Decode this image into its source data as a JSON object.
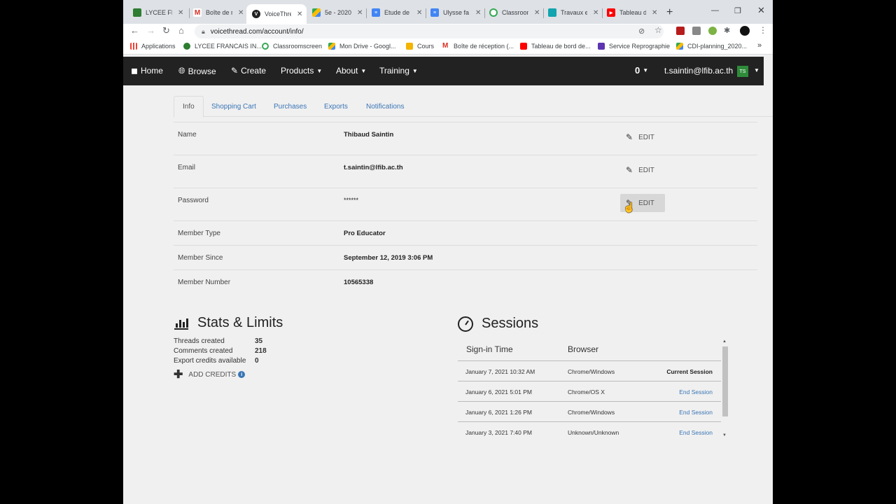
{
  "browser": {
    "tabs": [
      {
        "label": "LYCEE FR",
        "color": "#2e7d32"
      },
      {
        "label": "Boîte de r",
        "color": "#d93025"
      },
      {
        "label": "VoiceThre",
        "color": "#222222"
      },
      {
        "label": "5e - 2020",
        "color": "#1a73e8"
      },
      {
        "label": "Etude de",
        "color": "#4285f4"
      },
      {
        "label": "Ulysse fa",
        "color": "#4285f4"
      },
      {
        "label": "Classroom",
        "color": "#34a853"
      },
      {
        "label": "Travaux e",
        "color": "#12a4af"
      },
      {
        "label": "Tableau d",
        "color": "#ff0000"
      }
    ],
    "new_tab": "+",
    "url": "voicethread.com/account/info/",
    "bookmarks": [
      {
        "label": "Applications",
        "color": "#ea4335"
      },
      {
        "label": "LYCEE FRANCAIS IN...",
        "color": "#2e7d32"
      },
      {
        "label": "Classroomscreen",
        "color": "#34a853"
      },
      {
        "label": "Mon Drive - Googl...",
        "color": "#fbbc04"
      },
      {
        "label": "Cours",
        "color": "#f4b400"
      },
      {
        "label": "Boîte de réception (...",
        "color": "#d93025"
      },
      {
        "label": "Tableau de bord de...",
        "color": "#ff0000"
      },
      {
        "label": "Service Reprographie",
        "color": "#5e35b1"
      },
      {
        "label": "CDI-planning_2020...",
        "color": "#fbbc04"
      }
    ],
    "more": "»"
  },
  "nav": {
    "home": "Home",
    "browse": "Browse",
    "create": "Create",
    "products": "Products",
    "about": "About",
    "training": "Training",
    "count": "0",
    "user_email": "t.saintin@lfib.ac.th",
    "avatar": "TS"
  },
  "subtabs": [
    "Info",
    "Shopping Cart",
    "Purchases",
    "Exports",
    "Notifications"
  ],
  "info": {
    "rows": [
      {
        "label": "Name",
        "value": "Thibaud Saintin",
        "edit": "EDIT"
      },
      {
        "label": "Email",
        "value": "t.saintin@lfib.ac.th",
        "edit": "EDIT"
      },
      {
        "label": "Password",
        "value": "******",
        "edit": "EDIT"
      },
      {
        "label": "Member Type",
        "value": "Pro Educator"
      },
      {
        "label": "Member Since",
        "value": "September 12, 2019 3:06 PM"
      },
      {
        "label": "Member Number",
        "value": "10565338"
      }
    ]
  },
  "stats": {
    "title": "Stats & Limits",
    "items": [
      {
        "label": "Threads created",
        "value": "35"
      },
      {
        "label": "Comments created",
        "value": "218"
      },
      {
        "label": "Export credits available",
        "value": "0"
      }
    ],
    "add_credits": "ADD CREDITS"
  },
  "sessions": {
    "title": "Sessions",
    "headers": {
      "time": "Sign-in Time",
      "browser": "Browser"
    },
    "rows": [
      {
        "time": "January 7, 2021 10:32 AM",
        "browser": "Chrome/Windows",
        "action": "Current Session"
      },
      {
        "time": "January 6, 2021 5:01 PM",
        "browser": "Chrome/OS X",
        "action": "End Session"
      },
      {
        "time": "January 6, 2021 1:26 PM",
        "browser": "Chrome/Windows",
        "action": "End Session"
      },
      {
        "time": "January 3, 2021 7:40 PM",
        "browser": "Unknown/Unknown",
        "action": "End Session"
      }
    ]
  }
}
